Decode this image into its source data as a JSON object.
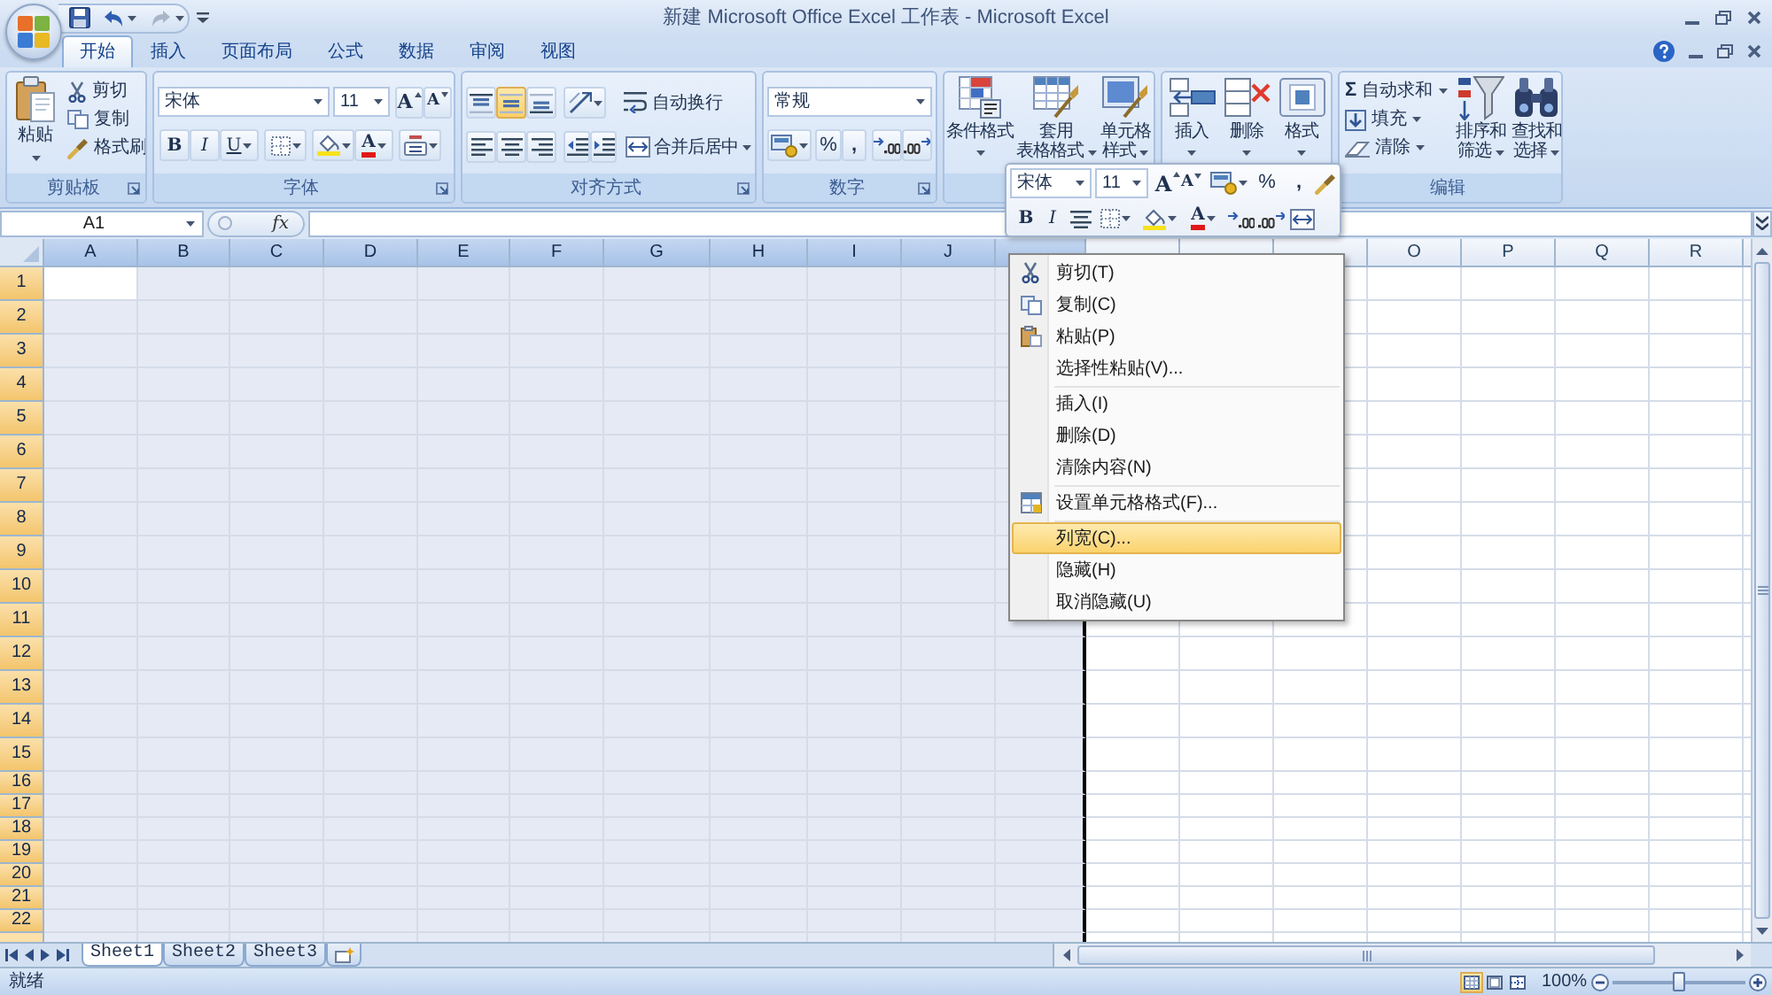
{
  "window": {
    "title": "新建 Microsoft Office Excel 工作表 - Microsoft Excel"
  },
  "quick_access": {
    "undo": {
      "disabled": false
    },
    "redo": {
      "disabled": true
    }
  },
  "tabs": [
    {
      "label": "开始",
      "selected": true
    },
    {
      "label": "插入",
      "selected": false
    },
    {
      "label": "页面布局",
      "selected": false
    },
    {
      "label": "公式",
      "selected": false
    },
    {
      "label": "数据",
      "selected": false
    },
    {
      "label": "审阅",
      "selected": false
    },
    {
      "label": "视图",
      "selected": false
    }
  ],
  "ribbon": {
    "clipboard": {
      "label": "剪贴板",
      "paste": "粘贴",
      "cut": "剪切",
      "copy": "复制",
      "format_painter": "格式刷"
    },
    "font": {
      "label": "字体",
      "font_name": "宋体",
      "font_size": "11",
      "grow_font": "A",
      "shrink_font": "A",
      "bold": "B",
      "italic": "I",
      "underline": "U",
      "font_color": "A"
    },
    "alignment": {
      "label": "对齐方式",
      "vertical": [
        {
          "selected": false
        },
        {
          "selected": true
        },
        {
          "selected": false
        }
      ],
      "horizontal": [
        {
          "selected": false
        },
        {
          "selected": false
        },
        {
          "selected": false
        }
      ],
      "wrap_text": "自动换行",
      "merge_center": "合并后居中"
    },
    "number": {
      "label": "数字",
      "format": "常规",
      "percent": "%",
      "comma": ","
    },
    "styles": {
      "conditional_format": "条件格式",
      "table_format": [
        "套用",
        "表格格式"
      ],
      "cell_styles": [
        "单元格",
        "样式"
      ]
    },
    "cells": {
      "insert": "插入",
      "delete": "删除",
      "format": "格式"
    },
    "editing": {
      "label": "编辑",
      "autosum_symbol": "Σ",
      "autosum": "自动求和",
      "fill": "填充",
      "clear": "清除",
      "sort_filter": [
        "排序和",
        "筛选"
      ],
      "find_select": [
        "查找和",
        "选择"
      ]
    }
  },
  "formula_bar": {
    "name_box": "A1",
    "function_button": "fx"
  },
  "grid": {
    "columns": [
      {
        "label": "A",
        "selected": true
      },
      {
        "label": "B",
        "selected": true
      },
      {
        "label": "C",
        "selected": true
      },
      {
        "label": "D",
        "selected": true
      },
      {
        "label": "E",
        "selected": true
      },
      {
        "label": "F",
        "selected": true
      },
      {
        "label": "G",
        "selected": true
      },
      {
        "label": "H",
        "selected": true
      },
      {
        "label": "I",
        "selected": true
      },
      {
        "label": "J",
        "selected": true
      },
      {
        "selected": true
      },
      {
        "selected": false
      },
      {
        "selected": false
      },
      {
        "selected": false
      },
      {
        "label": "O",
        "selected": false
      },
      {
        "label": "P",
        "selected": false
      },
      {
        "label": "Q",
        "selected": false
      },
      {
        "label": "R",
        "selected": false
      }
    ],
    "rows": [
      {
        "label": "1",
        "selected": true
      },
      {
        "label": "2",
        "selected": true
      },
      {
        "label": "3",
        "selected": true
      },
      {
        "label": "4",
        "selected": true
      },
      {
        "label": "5",
        "selected": true
      },
      {
        "label": "6",
        "selected": true
      },
      {
        "label": "7",
        "selected": true
      },
      {
        "label": "8",
        "selected": true
      },
      {
        "label": "9",
        "selected": true
      },
      {
        "label": "10",
        "selected": true
      },
      {
        "label": "11",
        "selected": true
      },
      {
        "label": "12",
        "selected": true
      },
      {
        "label": "13",
        "selected": true
      },
      {
        "label": "14",
        "selected": true
      },
      {
        "label": "15",
        "selected": true
      },
      {
        "label": "16",
        "selected": true
      },
      {
        "label": "17",
        "selected": true
      },
      {
        "label": "18",
        "selected": true
      },
      {
        "label": "19",
        "selected": true
      },
      {
        "label": "20",
        "selected": true
      },
      {
        "label": "21",
        "selected": true
      },
      {
        "label": "22",
        "selected": true
      }
    ]
  },
  "mini_toolbar": {
    "font_name": "宋体",
    "font_size": "11",
    "grow_font": "A",
    "shrink_font": "A",
    "percent": "%",
    "comma": ",",
    "bold": "B",
    "italic": "I",
    "font_color": "A"
  },
  "context_menu": {
    "sections": [
      {
        "items": [
          {
            "label": "剪切(T)",
            "kind": "cut",
            "selected": false
          },
          {
            "label": "复制(C)",
            "kind": "copy",
            "selected": false
          },
          {
            "label": "粘贴(P)",
            "kind": "paste",
            "selected": false
          },
          {
            "label": "选择性粘贴(V)...",
            "kind": "plain",
            "selected": false
          }
        ]
      },
      {
        "items": [
          {
            "label": "插入(I)",
            "kind": "plain",
            "selected": false
          },
          {
            "label": "删除(D)",
            "kind": "plain",
            "selected": false
          },
          {
            "label": "清除内容(N)",
            "kind": "plain",
            "selected": false
          }
        ]
      },
      {
        "items": [
          {
            "label": "设置单元格格式(F)...",
            "kind": "format",
            "selected": false
          }
        ]
      },
      {
        "items": [
          {
            "label": "列宽(C)...",
            "kind": "plain",
            "selected": true
          },
          {
            "label": "隐藏(H)",
            "kind": "plain",
            "selected": false
          },
          {
            "label": "取消隐藏(U)",
            "kind": "plain",
            "selected": false
          }
        ]
      }
    ]
  },
  "sheet_tabs": [
    {
      "label": "Sheet1",
      "selected": true
    },
    {
      "label": "Sheet2",
      "selected": false
    },
    {
      "label": "Sheet3",
      "selected": false
    }
  ],
  "status_bar": {
    "status": "就绪",
    "views": [
      {
        "selected": true
      },
      {
        "selected": false
      },
      {
        "selected": false
      }
    ],
    "zoom": "100%",
    "zoom_slider": {
      "level": 0.5
    }
  }
}
